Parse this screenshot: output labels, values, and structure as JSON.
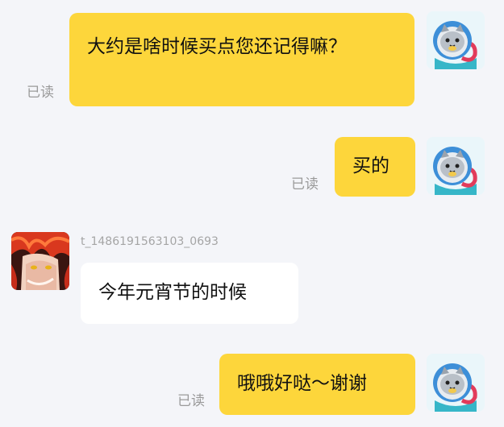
{
  "messages": [
    {
      "side": "me",
      "text": "大约是啥时候买点您还记得嘛？",
      "status": "已读",
      "avatar": "cat-avatar-icon"
    },
    {
      "side": "me",
      "text": "买的",
      "status": "已读",
      "avatar": "cat-avatar-icon"
    },
    {
      "side": "other",
      "username": "t_1486191563103_0693",
      "text": "今年元宵节的时候",
      "avatar": "anime-avatar-icon"
    },
    {
      "side": "me",
      "text": "哦哦好哒～谢谢",
      "status": "已读",
      "avatar": "cat-avatar-icon"
    }
  ],
  "colors": {
    "background": "#f4f5f9",
    "my_bubble": "#fdd63b",
    "their_bubble": "#ffffff",
    "read_status": "#9a9a9a",
    "username": "#a5a5a5"
  }
}
